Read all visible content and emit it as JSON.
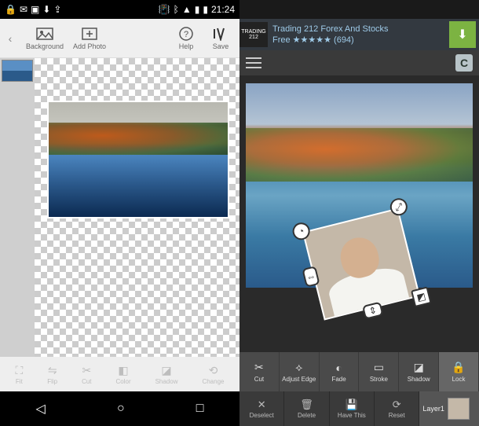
{
  "left": {
    "status": {
      "time": "21:24"
    },
    "toolbar": {
      "background": "Background",
      "add_photo": "Add Photo",
      "help": "Help",
      "save": "Save"
    },
    "bottom_tools": {
      "fit": "Fit",
      "flip": "Flip",
      "cut": "Cut",
      "color": "Color",
      "shadow": "Shadow",
      "change": "Change"
    }
  },
  "right": {
    "ad": {
      "logo_top": "TRADING",
      "logo_num": "212",
      "title": "Trading 212 Forex And Stocks",
      "subtitle": "Free ★★★★★ (694)"
    },
    "badge": "C",
    "tools_row1": {
      "cut": "Cut",
      "adjust_edge": "Adjust Edge",
      "fade": "Fade",
      "stroke": "Stroke",
      "shadow": "Shadow",
      "lock": "Lock"
    },
    "tools_row2": {
      "deselect": "Deselect",
      "delete": "Delete",
      "have_this": "Have This",
      "reset": "Reset",
      "layer_label": "Layer1"
    }
  }
}
